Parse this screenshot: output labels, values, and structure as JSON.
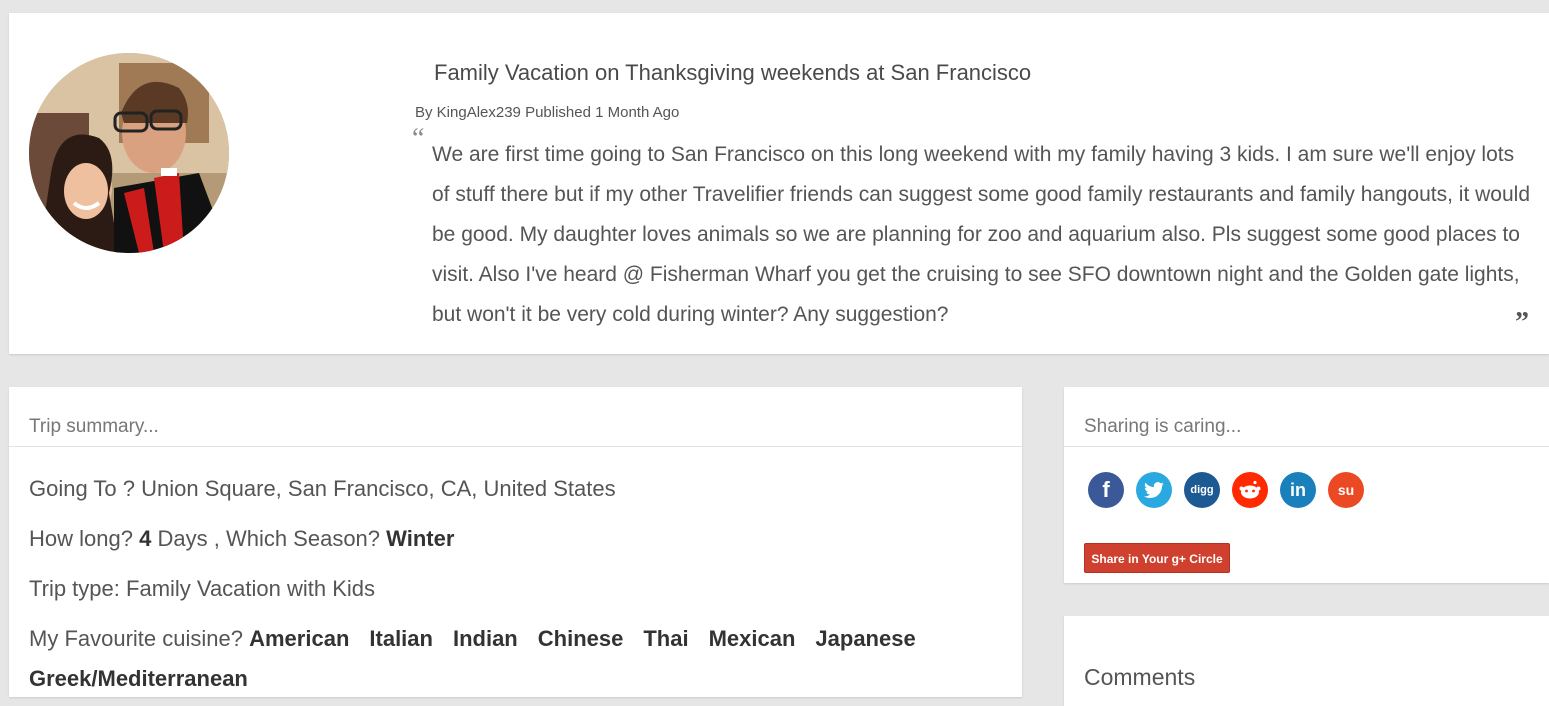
{
  "post": {
    "title": "Family Vacation on Thanksgiving weekends at San Francisco",
    "meta": "By KingAlex239 Published 1 Month Ago",
    "quote_open": "“",
    "quote_close": "”",
    "body": "We are first time going to San Francisco on this long weekend with my family having 3 kids. I am sure we'll enjoy lots of stuff there but if my other Travelifier friends can suggest some good family restaurants and family hangouts, it would be good. My daughter loves animals so we are planning for zoo and aquarium also. Pls suggest some good places to visit. Also I've heard @ Fisherman Wharf you get the cruising to see SFO downtown night and the Golden gate lights, but won't it be very cold during winter? Any suggestion?"
  },
  "summary": {
    "header": "Trip summary...",
    "going_to_label": "Going To ?",
    "going_to_value": "Union Square, San Francisco, CA, United States",
    "how_long_label": "How long?",
    "days_value": "4",
    "days_unit": "Days ,",
    "season_label": "Which Season?",
    "season_value": "Winter",
    "trip_type_label": "Trip type:",
    "trip_type_value": "Family Vacation with Kids",
    "cuisine_label": "My Favourite cuisine?",
    "cuisines": [
      "American",
      "Italian",
      "Indian",
      "Chinese",
      "Thai",
      "Mexican",
      "Japanese",
      "Greek/Mediterranean"
    ]
  },
  "share": {
    "header": "Sharing is caring...",
    "icons": [
      {
        "name": "facebook-icon",
        "glyph": "f",
        "color": "#3b5998"
      },
      {
        "name": "twitter-icon",
        "glyph": "t",
        "color": "#2aa9e0"
      },
      {
        "name": "digg-icon",
        "glyph": "digg",
        "color": "#1d5a94"
      },
      {
        "name": "reddit-icon",
        "glyph": "●",
        "color": "#ff2a00"
      },
      {
        "name": "linkedin-icon",
        "glyph": "in",
        "color": "#1a80bb"
      },
      {
        "name": "stumbleupon-icon",
        "glyph": "su",
        "color": "#eb4924"
      }
    ],
    "gplus_button": "Share in Your g+ Circle"
  },
  "comments": {
    "title": "Comments"
  }
}
